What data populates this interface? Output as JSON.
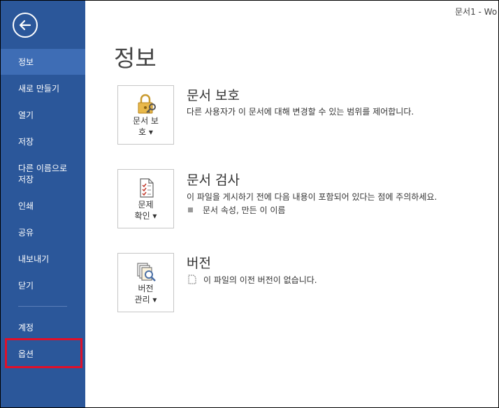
{
  "window": {
    "title": "문서1 - Wo"
  },
  "sidebar": {
    "items": [
      {
        "label": "정보",
        "active": true
      },
      {
        "label": "새로 만들기"
      },
      {
        "label": "열기"
      },
      {
        "label": "저장"
      },
      {
        "label": "다른 이름으로\n저장"
      },
      {
        "label": "인쇄"
      },
      {
        "label": "공유"
      },
      {
        "label": "내보내기"
      },
      {
        "label": "닫기"
      },
      {
        "label": "계정"
      },
      {
        "label": "옵션",
        "highlighted": true
      }
    ]
  },
  "main": {
    "title": "정보",
    "sections": [
      {
        "tile_label": "문서 보\n호 ▾",
        "heading": "문서 보호",
        "description": "다른 사용자가 이 문서에 대해 변경할 수 있는 범위를 제어합니다."
      },
      {
        "tile_label": "문제\n확인 ▾",
        "heading": "문서 검사",
        "description": "이 파일을 게시하기 전에 다음 내용이 포함되어 있다는 점에 주의하세요.",
        "sub_item": "문서 속성, 만든 이 이름"
      },
      {
        "tile_label": "버전\n관리 ▾",
        "heading": "버전",
        "description": "이 파일의 이전 버전이 없습니다."
      }
    ]
  },
  "colors": {
    "sidebar": "#2b579a",
    "active": "#3e6db5",
    "highlight": "#e0102a"
  }
}
